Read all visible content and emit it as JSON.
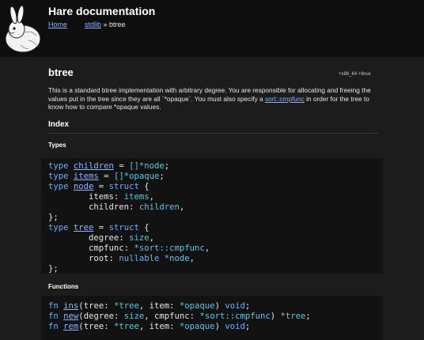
{
  "header": {
    "logo_name": "hare-rabbit-logo",
    "title": "Hare documentation",
    "nav_home": "Home",
    "nav_stdlib": "stdlib",
    "nav_sep": " » ",
    "nav_current": "btree"
  },
  "module": {
    "title": "btree",
    "platform": "+x86_64 +linux",
    "description_part1": "This is a standard btree implementation with arbitrary degree. You are responsible for allocating and freeing the values put in the tree since they are all `*opaque`. You must also specify a ",
    "description_link": "sort::cmpfunc",
    "description_part2": " in order for the tree to know how to compare *opaque values."
  },
  "index": {
    "heading": "Index",
    "types_heading": "Types",
    "functions_heading": "Functions"
  },
  "code": {
    "type_kw": "type",
    "struct_kw": "struct",
    "fn_kw": "fn",
    "void_kw": "void",
    "nullable_kw": "nullable",
    "children_name": "children",
    "items_name": "items",
    "node_name": "node",
    "tree_name": "tree",
    "slice_node": "[]*node",
    "slice_opaque": "[]*opaque",
    "field_items": "items",
    "field_children": "children",
    "field_degree": "degree",
    "field_cmpfunc": "cmpfunc",
    "field_root": "root",
    "type_size": "size",
    "type_cmpfunc": "*sort::cmpfunc",
    "type_ptr_node": "*node",
    "type_ptr_tree": "*tree",
    "type_ptr_opaque": "*opaque",
    "fn_ins": "ins",
    "fn_new": "new",
    "fn_rem": "rem",
    "param_tree": "tree",
    "param_item": "item",
    "param_degree": "degree",
    "param_cmpfunc": "cmpfunc"
  }
}
